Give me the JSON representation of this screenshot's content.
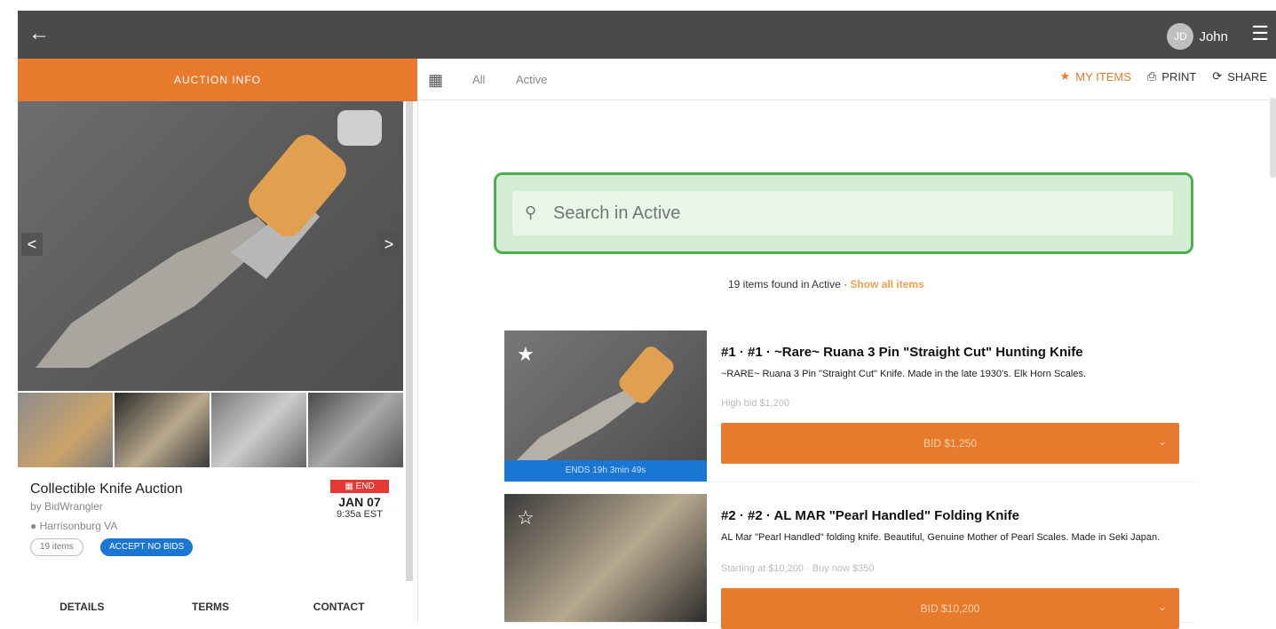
{
  "topbar": {
    "back_icon": "arrow-left-icon",
    "user_initials": "JD",
    "user_name": "John",
    "menu_icon": "hamburger-icon"
  },
  "left": {
    "tab_label": "AUCTION INFO",
    "prev_label": "<",
    "next_label": ">",
    "auction_title": "Collectible Knife Auction",
    "by_line": "by BidWrangler",
    "location": "Harrisonburg VA",
    "items_chip": "19 items",
    "accept_chip": "ACCEPT NO BIDS",
    "end_badge": "END",
    "end_date": "JAN 07",
    "end_time": "9:35a EST",
    "tabs": [
      "DETAILS",
      "TERMS",
      "CONTACT"
    ]
  },
  "toolbar": {
    "tab_all": "All",
    "tab_active": "Active",
    "my_items": "MY ITEMS",
    "print": "PRINT",
    "share": "SHARE"
  },
  "search": {
    "placeholder": "Search in Active"
  },
  "found": {
    "text": "19 items found in Active · ",
    "show_all": "Show all items"
  },
  "items": [
    {
      "title": "#1 · #1 · ~Rare~ Ruana 3 Pin \"Straight Cut\" Hunting Knife",
      "desc": "~RARE~ Ruana 3 Pin \"Straight Cut\" Knife. Made in the late 1930's. Elk Horn Scales.",
      "sub": "High bid $1,200",
      "ends": "ENDS 19h 3min 49s",
      "bid_label": "BID $1,250",
      "starred": true
    },
    {
      "title": "#2 · #2 · AL MAR \"Pearl Handled\" Folding Knife",
      "desc": "AL Mar \"Pearl Handled\" folding knife. Beautiful, Genuine Mother of Pearl Scales. Made in Seki Japan.",
      "sub": "Starting at $10,200 · Buy now $350",
      "bid_label": "BID $10,200",
      "starred": false
    }
  ]
}
